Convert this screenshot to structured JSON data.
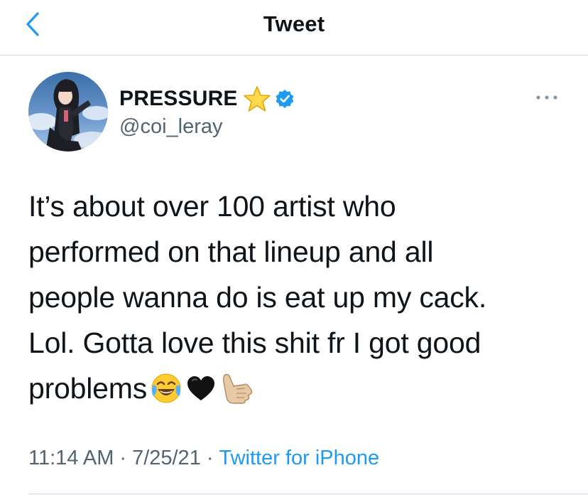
{
  "header": {
    "title": "Tweet",
    "back_icon": "chevron-left-icon"
  },
  "author": {
    "display_name": "PRESSURE",
    "handle": "@coi_leray",
    "name_emoji": "star-icon",
    "verified": "verified-badge-icon",
    "avatar": "anime-girl-avatar"
  },
  "tweet": {
    "lines": [
      "It’s about over 100 artist who",
      "performed on that lineup and all",
      "people wanna do is eat up my cack.",
      "Lol. Gotta love this shit fr I got good",
      "problems"
    ],
    "emojis": [
      "face-with-tears-of-joy-icon",
      "black-heart-icon",
      "call-me-hand-icon"
    ]
  },
  "meta": {
    "time": "11:14 AM",
    "date": "7/25/21",
    "separator": "·",
    "source": "Twitter for iPhone"
  },
  "more_icon": "more-dots-icon",
  "colors": {
    "accent": "#1d9bf0",
    "secondary_text": "#536471",
    "primary_text": "#0f1419",
    "divider": "#cfd9de"
  }
}
